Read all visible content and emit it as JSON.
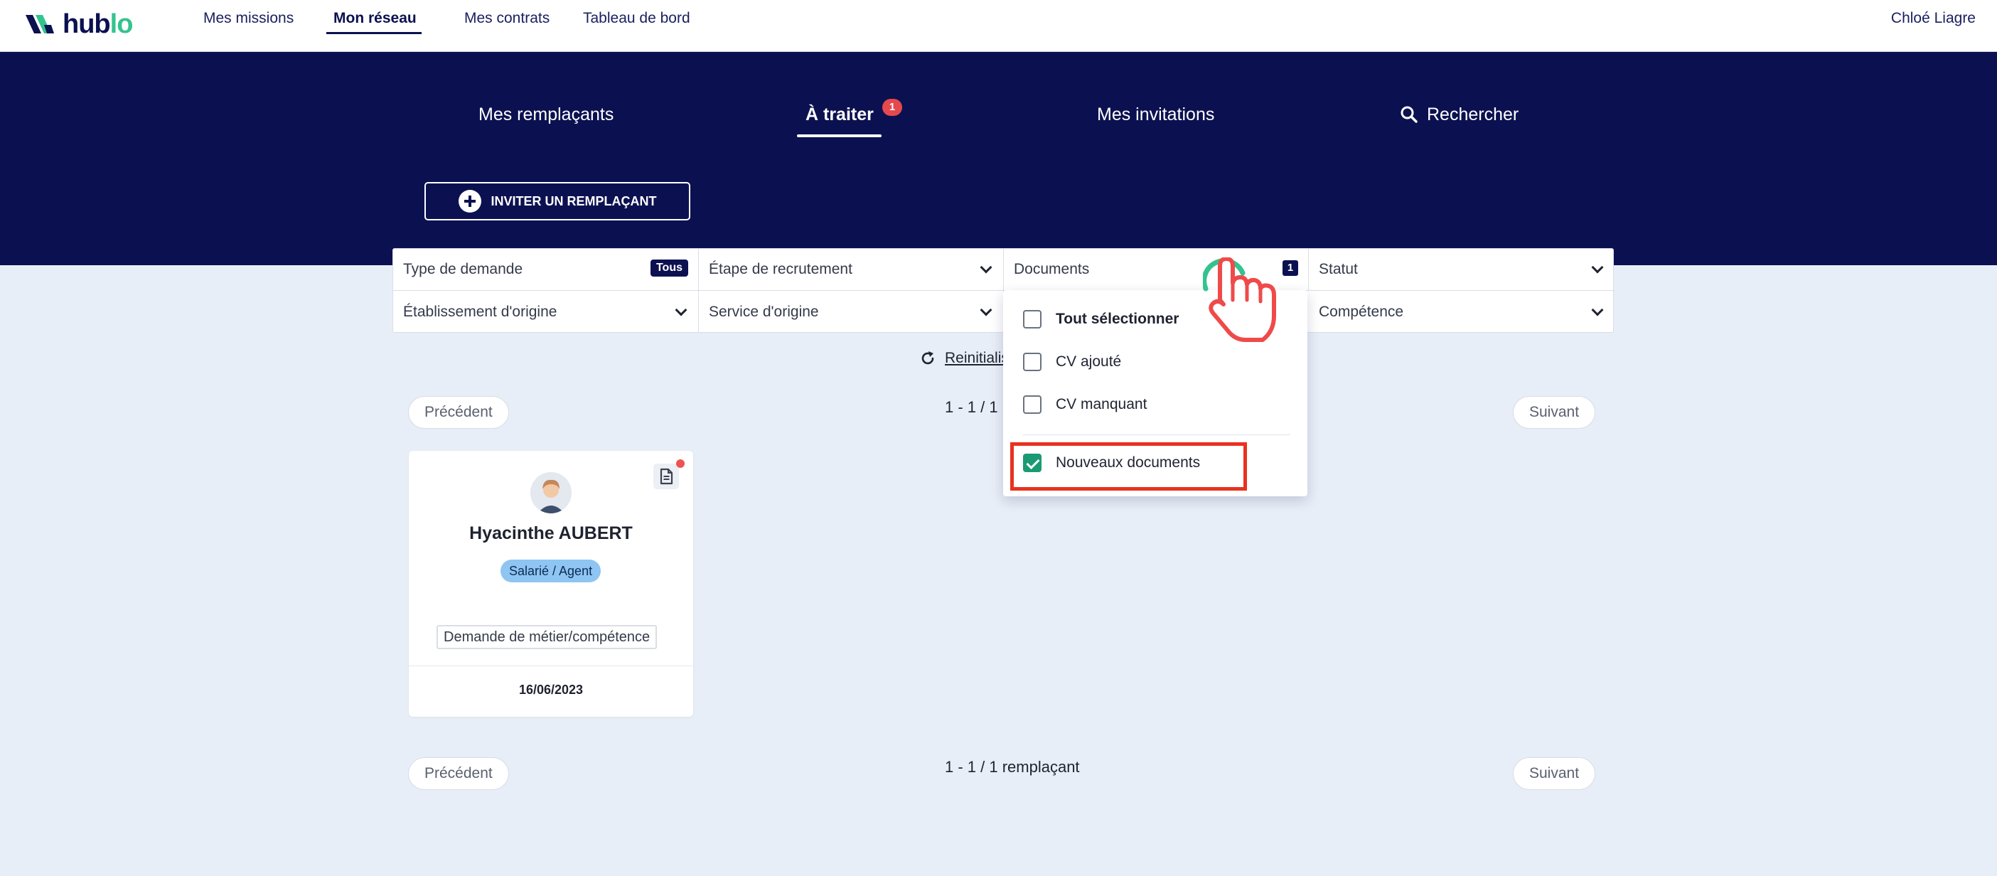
{
  "logo": {
    "text_part1": "hub",
    "text_part2": "lo"
  },
  "topnav": {
    "items": [
      {
        "label": "Mes missions"
      },
      {
        "label": "Mon réseau"
      },
      {
        "label": "Mes contrats"
      },
      {
        "label": "Tableau de bord"
      }
    ],
    "active": "Mon réseau",
    "user_name": "Chloé Liagre"
  },
  "tabs": {
    "items": [
      {
        "label": "Mes remplaçants"
      },
      {
        "label": "À traiter",
        "badge": "1"
      },
      {
        "label": "Mes invitations"
      },
      {
        "label": "Rechercher"
      }
    ],
    "active": "À traiter"
  },
  "invite_button": {
    "label": "INVITER UN REMPLAÇANT"
  },
  "filters": {
    "type_demande": {
      "label": "Type de demande",
      "tag": "Tous"
    },
    "etape_recrutement": {
      "label": "Étape de recrutement"
    },
    "documents": {
      "label": "Documents",
      "count": "1"
    },
    "statut": {
      "label": "Statut"
    },
    "etablissement_origine": {
      "label": "Établissement d'origine"
    },
    "service_origine": {
      "label": "Service d'origine"
    },
    "competence": {
      "label": "Compétence"
    }
  },
  "documents_dropdown": {
    "options": [
      {
        "label": "Tout sélectionner",
        "checked": false
      },
      {
        "label": "CV ajouté",
        "checked": false
      },
      {
        "label": "CV manquant",
        "checked": false
      },
      {
        "label": "Nouveaux documents",
        "checked": true
      }
    ]
  },
  "reset": {
    "label": "Reinitialis"
  },
  "pagination": {
    "prev_label": "Précédent",
    "next_label": "Suivant",
    "top_summary": "1 - 1 / 1 r",
    "bottom_summary": "1 - 1 / 1 remplaçant"
  },
  "cards": [
    {
      "name": "Hyacinthe AUBERT",
      "role": "Salarié / Agent",
      "request": "Demande de métier/compétence",
      "date": "16/06/2023"
    }
  ],
  "colors": {
    "brand_navy": "#0b1150",
    "brand_green": "#34c38f",
    "check_green": "#1a9a72",
    "badge_red": "#e5484d",
    "highlight_red": "#e8321f",
    "page_bg": "#e8eef7",
    "role_badge_bg": "#8ec5f2"
  },
  "icons": [
    "logo-mark",
    "search-icon",
    "plus-circle-icon",
    "chevron-down-icon",
    "refresh-icon",
    "document-icon",
    "avatar",
    "pointer-hand-cursor"
  ]
}
